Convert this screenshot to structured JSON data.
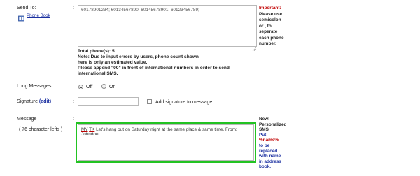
{
  "send_to": {
    "label": "Send To:",
    "colon": ":",
    "phone_book_label": "Phone Book",
    "numbers_value": "60178901234; 60134567890; 60145678901; 60123456789;",
    "important_title": "Important:",
    "important_lines": [
      "Please use",
      "semicolon ;",
      "or , to",
      "seperate",
      "each phone",
      "number."
    ]
  },
  "phones_note": {
    "total": "Total phone(s): 5",
    "line1": "Note: Due to input errors by users, phone count shown",
    "line2": "here is only an estimated value.",
    "line3": "Please append \"00\" in front of international numbers in order to send",
    "line4": "international SMS."
  },
  "long_messages": {
    "label": "Long Messages",
    "colon": ":",
    "off_label": "Off",
    "on_label": "On",
    "selected": "Off"
  },
  "signature": {
    "label": "Signature",
    "edit_label": "(edit)",
    "colon": ":",
    "value": "",
    "add_label": "Add signature to message"
  },
  "message": {
    "label": "Message",
    "colon": ":",
    "chars_left": "( 76 character lefts )",
    "token_my": "MY",
    "token_tk": "TK",
    "body_rest": " Let's hang out on Saturday night at the same place & same time. From: Johndoe",
    "new_lines": [
      "New!",
      "Personalized",
      "SMS"
    ],
    "put_label": "Put",
    "name_token": "%name%",
    "replace_lines": [
      "to be",
      "replaced",
      "with name",
      "in address",
      "book."
    ]
  },
  "colors": {
    "highlight_border": "#22c322",
    "accent_red": "#c00000",
    "link_blue": "#1a2fa0"
  }
}
